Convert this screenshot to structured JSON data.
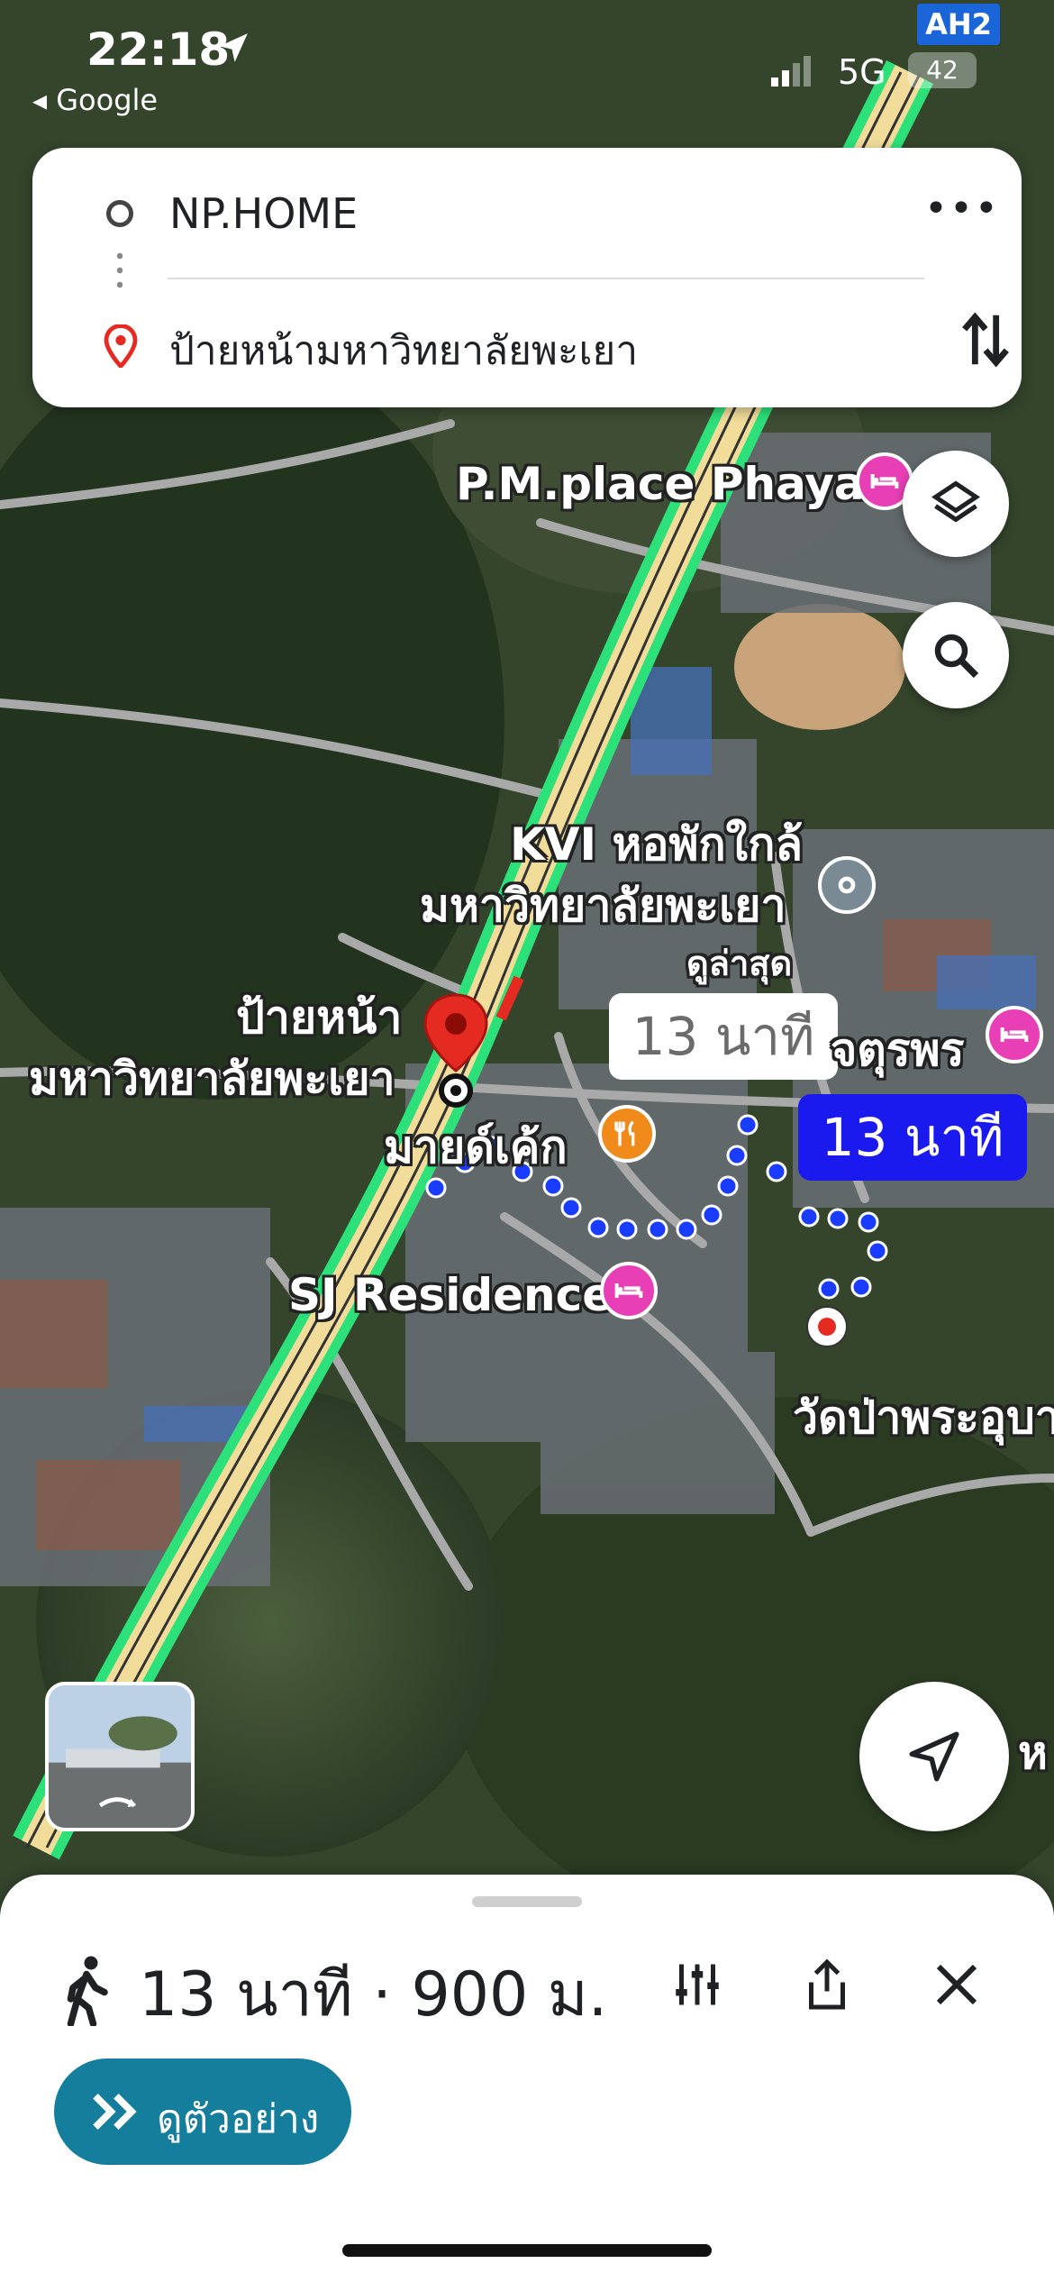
{
  "status_bar": {
    "time": "22:18",
    "back_app": "◂ Google",
    "network": "5G",
    "battery": "42",
    "highway_shield": "AH2"
  },
  "route": {
    "origin": "NP.HOME",
    "destination": "ป้ายหน้ามหาวิทยาลัยพะเยา"
  },
  "map": {
    "poi_pm_place": "P.M.place Phayao",
    "poi_kvi_line1": "KVI หอพักใกล้",
    "poi_kvi_line2": "มหาวิทยาลัยพะเยา",
    "poi_kvi_sub": "ดูล่าสุด",
    "dest_label_line1": "ป้ายหน้า",
    "dest_label_line2": "มหาวิทยาลัยพะเยา",
    "poi_mind_cake": "มายด์เค้ก",
    "poi_sj": "SJ Residence",
    "poi_jaturaporn": "จตุรพร",
    "poi_wat": "วัดป่าพระอุบา",
    "edge_text": "ห",
    "bubble_alt": "13 นาที",
    "bubble_selected": "13 นาที",
    "colors": {
      "route_dots": "#1a3cff",
      "traffic_green": "#2ce07a",
      "highway_fill": "#f1dc9a",
      "poi_hotel": "#e83fb6",
      "poi_food": "#f08a1b",
      "dest_pin": "#e52b21"
    }
  },
  "bottom_sheet": {
    "summary": "13 นาที · 900 ม.",
    "preview_button": "ดูตัวอย่าง",
    "accent": "#157e9c"
  },
  "icons": [
    "layers-icon",
    "search-icon",
    "locate-icon",
    "walk-icon",
    "filter-icon",
    "share-icon",
    "close-icon",
    "swap-icon",
    "more-icon"
  ]
}
